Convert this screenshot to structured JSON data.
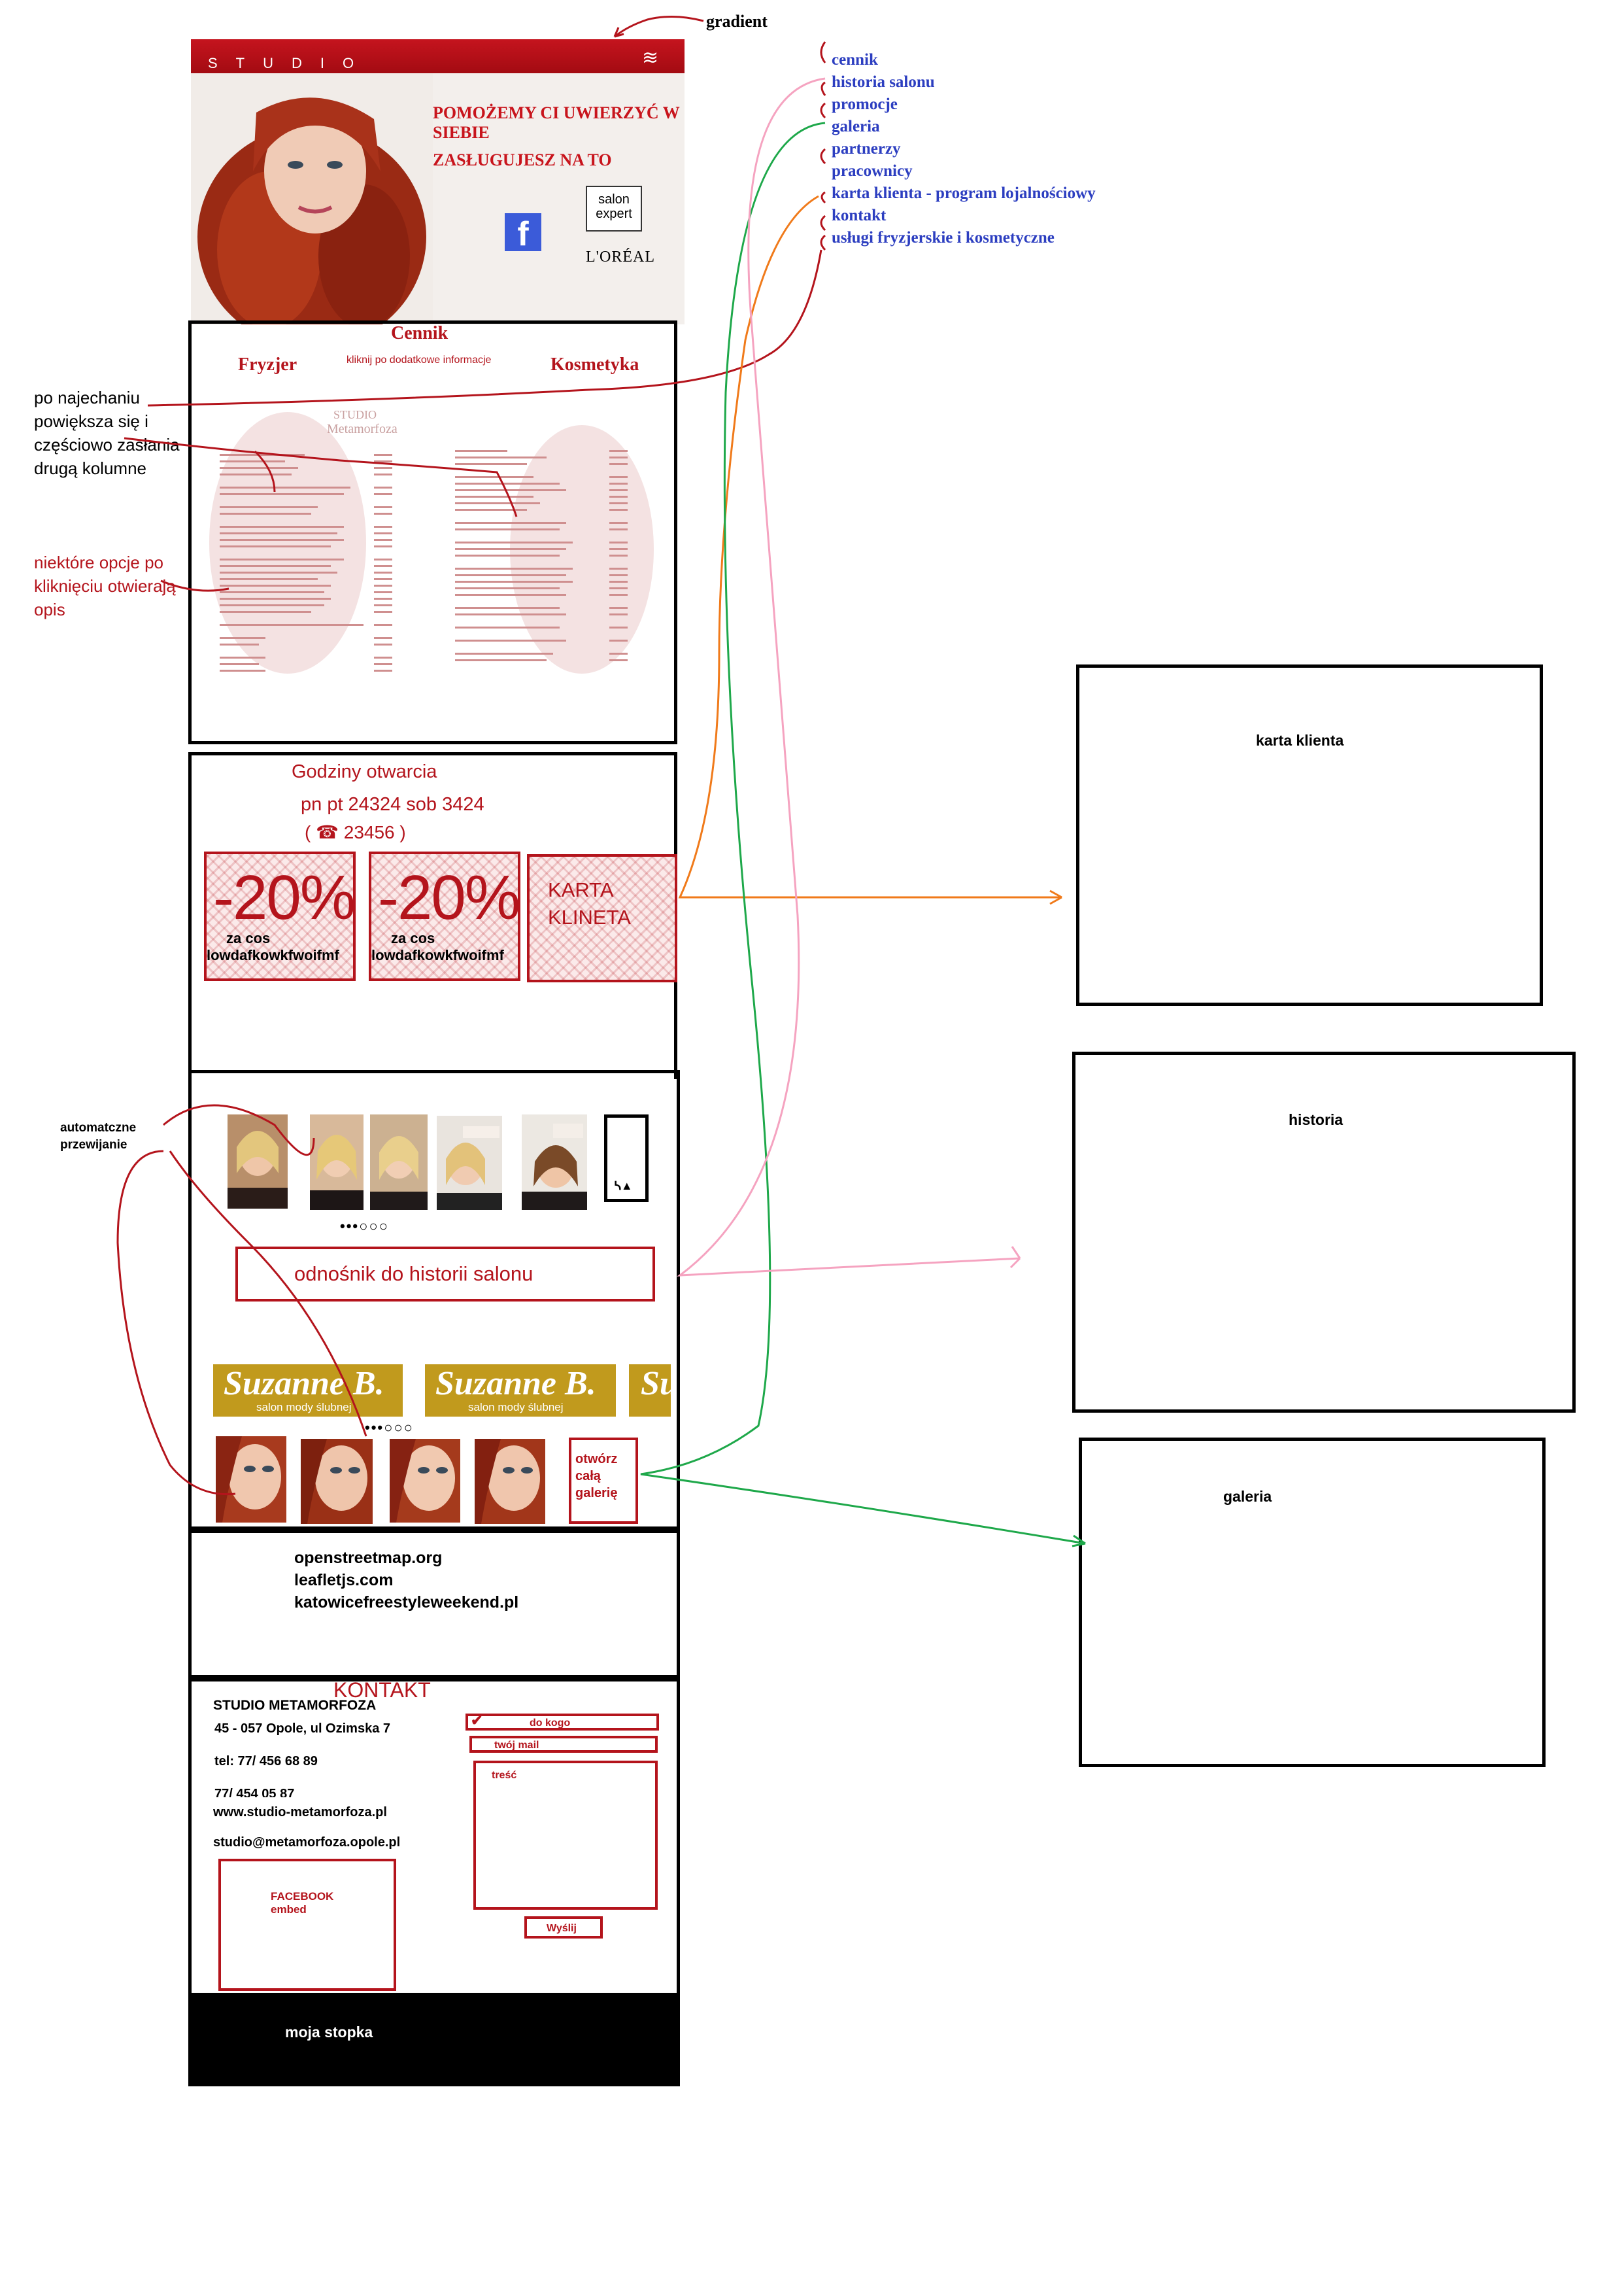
{
  "annotations": {
    "gradient": "gradient",
    "hover": "po najechaniu powiększa się  i częściowo zasłania drugą kolumne",
    "click": "niektóre opcje po kliknięciu otwierają opis",
    "autoscroll": "automatczne przewijanie"
  },
  "header": {
    "logo": "STUDIO",
    "menu_icon": "≋",
    "slogan1": "POMOŻEMY CI UWIERZYĆ W SIEBIE",
    "slogan2": "ZASŁUGUJESZ NA TO",
    "facebook_icon": "f",
    "salon_expert": "salon expert",
    "loreal": "L'ORÉAL"
  },
  "menu": [
    "cennik",
    "historia salonu",
    "promocje",
    "galeria",
    "partnerzy",
    "pracownicy",
    "karta klienta - program lojalnościowy",
    "kontakt",
    "usługi fryzjerskie i kosmetyczne"
  ],
  "cennik": {
    "title": "Cennik",
    "left_tab": "Fryzjer",
    "hint": "kliknij po dodatkowe informacje",
    "right_tab": "Kosmetyka"
  },
  "hours": {
    "title": "Godziny otwarcia",
    "times": "pn pt 24324 sob 3424",
    "phone": "( ☎ 23456 )"
  },
  "promos": [
    {
      "big": "-20%",
      "line1": "za cos",
      "line2": "lowdafkowkfwoifmf"
    },
    {
      "big": "-20%",
      "line1": "za cos",
      "line2": "lowdafkowkfwoifmf"
    }
  ],
  "card_tile": "KARTA KLINETA",
  "history_link": "odnośnik do historii salonu",
  "suzanne": {
    "title": "Suzanne B.",
    "sub": "salon mody ślubnej",
    "cut": "Su"
  },
  "gallery_button": "otwórz całą galerię",
  "partners": [
    "openstreetmap.org",
    "leafletjs.com",
    "katowicefreestyleweekend.pl"
  ],
  "contact": {
    "title": "KONTAKT",
    "name": "STUDIO METAMORFOZA",
    "address": "45 - 057 Opole, ul Ozimska 7",
    "tel1": "tel: 77/ 456 68 89",
    "tel2": "77/ 454 05 87",
    "www": "www.studio-metamorfoza.pl",
    "email": "studio@metamorfoza.opole.pl",
    "fb_embed_1": "FACEBOOK",
    "fb_embed_2": "embed",
    "to_field": "do kogo",
    "mail_field": "twój mail",
    "body_field": "treść",
    "send": "Wyślij"
  },
  "footer": "moja stopka",
  "side_boxes": {
    "card": "karta klienta",
    "history": "historia",
    "gallery": "galeria"
  },
  "colors": {
    "accent": "#b4141c",
    "menu_blue": "#2c3ec0",
    "suzanne_gold": "#c19a1d"
  }
}
